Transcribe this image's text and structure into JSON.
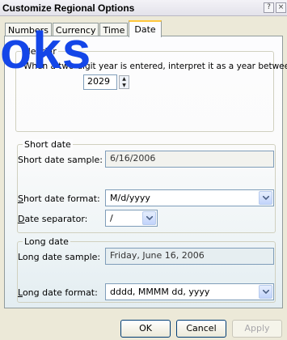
{
  "window": {
    "title": "Customize Regional Options",
    "help_label": "?",
    "close_label": "×"
  },
  "tabs": [
    {
      "label": "Numbers"
    },
    {
      "label": "Currency"
    },
    {
      "label": "Time"
    },
    {
      "label": "Date",
      "active": true
    }
  ],
  "calendar": {
    "legend": "alendar",
    "description": "When a two-digit year is entered, interpret it as a year between:",
    "year_value": "2029"
  },
  "short_date": {
    "legend": "Short date",
    "sample_label": "Short date sample:",
    "sample_value": "6/16/2006",
    "format_label_u": "S",
    "format_label_rest": "hort date format:",
    "format_value": "M/d/yyyy",
    "separator_label_u": "D",
    "separator_label_rest": "ate separator:",
    "separator_value": "/"
  },
  "long_date": {
    "legend": "Long date",
    "sample_label": "Long date sample:",
    "sample_value": "Friday, June 16, 2006",
    "format_label_u": "L",
    "format_label_rest": "ong date format:",
    "format_value": "dddd, MMMM dd, yyyy"
  },
  "buttons": {
    "ok": "OK",
    "cancel": "Cancel",
    "apply": "Apply"
  },
  "overlay": {
    "watermark": "oks"
  },
  "colors": {
    "accent_tab": "#ffc73c",
    "watermark": "#1446e8"
  }
}
